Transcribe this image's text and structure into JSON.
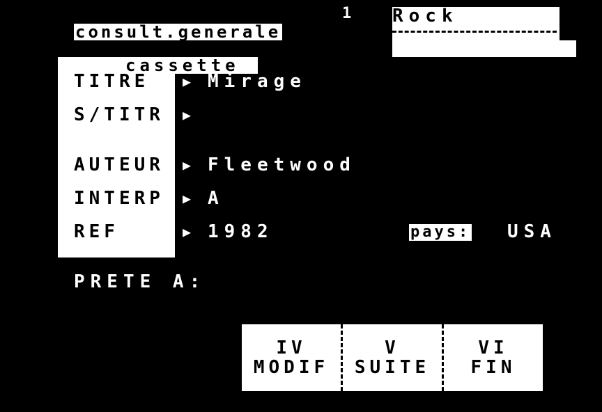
{
  "header": {
    "title": "consult.generale",
    "page_number": "1",
    "genre": "Rock"
  },
  "media_type": "cassette",
  "fields": [
    {
      "id": "titre",
      "label": "TITRE",
      "value": "Mirage"
    },
    {
      "id": "sous-titre",
      "label": "S/TITR",
      "value": ""
    },
    {
      "id": "auteur",
      "label": "AUTEUR",
      "value": "Fleetwood"
    },
    {
      "id": "interprete",
      "label": "INTERP",
      "value": "A"
    },
    {
      "id": "ref",
      "label": "REF",
      "value": "1982"
    }
  ],
  "arrow_icon": "right-triangle-icon",
  "country": {
    "label": "pays:",
    "value": "USA"
  },
  "loan": {
    "label": "PRETE A:"
  },
  "function_keys": [
    {
      "number": "IV",
      "label": "MODIF"
    },
    {
      "number": "V",
      "label": "SUITE"
    },
    {
      "number": "VI",
      "label": "FIN"
    }
  ],
  "colors": {
    "background": "#000000",
    "foreground": "#ffffff"
  }
}
